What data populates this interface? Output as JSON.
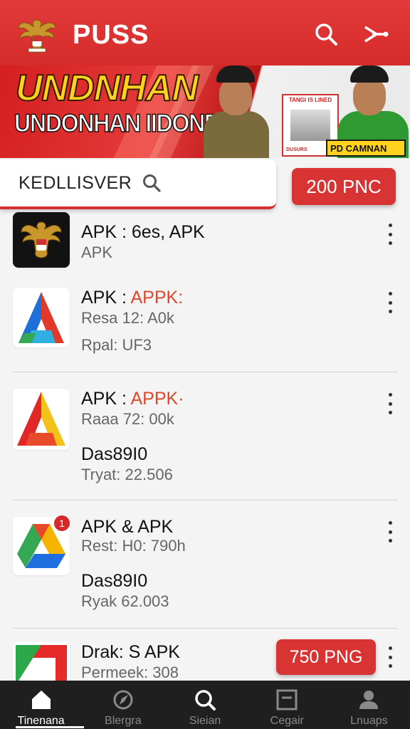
{
  "header": {
    "title": "PUSS",
    "logo": "garuda-emblem",
    "search_icon": "search-icon",
    "share_icon": "share-icon",
    "color": "#d82e2e"
  },
  "banner": {
    "headline": "UNDNHAN",
    "subheadline": "UNDONHAN IIDONESIA",
    "poster_title": "TANGI IS LINED",
    "poster_foot": "DUSURS",
    "badge": "PD CAMNAN"
  },
  "search": {
    "text": "KEDLLISVER",
    "top_button": "200 PNC"
  },
  "apps": [
    {
      "line1": "APK : 6es, APK",
      "line2": "APK",
      "icon": "garuda-emblem"
    },
    {
      "line1_prefix": "APK : ",
      "line1_highlight": "APPK:",
      "line2": "Resa 12: A0k",
      "line3": "Rpal: UF3",
      "icon": "blue-red-a-logo"
    },
    {
      "line1_prefix": "APK : ",
      "line1_highlight": "APPK·",
      "line2": "Raaa 72: 00k",
      "line3": "Das89I0",
      "line4": "Tryat: 22.506",
      "icon": "red-yellow-a-logo"
    },
    {
      "line1": "APK & APK",
      "line2": "Rest: H0: 790h",
      "line3": "Das89I0",
      "line4": "Ryak 62.003",
      "icon": "drive-style-logo",
      "badge": "1"
    },
    {
      "line1": "Drak: S APK",
      "line2": "Permeek: 308",
      "button": "750 PNG",
      "icon": "green-red-logo"
    }
  ],
  "nav": {
    "items": [
      {
        "label": "Tinenana",
        "icon": "home-icon",
        "active": true
      },
      {
        "label": "Blergra",
        "icon": "compass-icon",
        "active": false
      },
      {
        "label": "Sieian",
        "icon": "search-icon",
        "active": false
      },
      {
        "label": "Cegair",
        "icon": "tray-icon",
        "active": false
      },
      {
        "label": "Lnuaps",
        "icon": "profile-icon",
        "active": false
      }
    ]
  }
}
